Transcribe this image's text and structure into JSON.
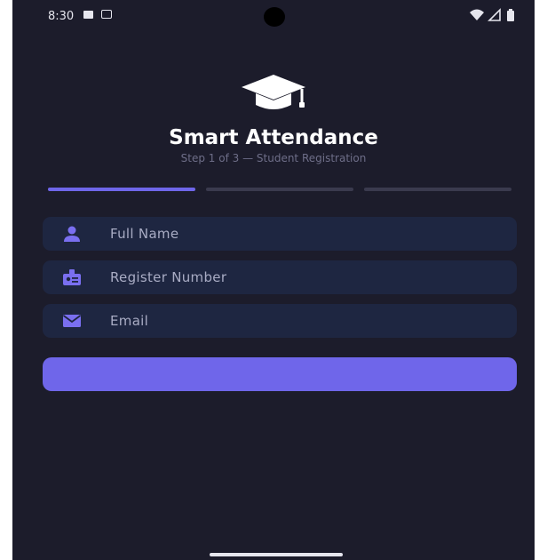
{
  "status_bar": {
    "time": "8:30",
    "icons": [
      "sd-card-icon",
      "screen-icon",
      "wifi-icon",
      "signal-icon",
      "battery-icon"
    ]
  },
  "header": {
    "icon": "graduation-cap-icon",
    "title": "Smart Attendance",
    "subtitle": "Step 1 of 3 — Student Registration"
  },
  "progress": {
    "current_step": 1,
    "total_steps": 3
  },
  "form": {
    "fields": [
      {
        "icon": "person-icon",
        "placeholder": "Full Name",
        "value": ""
      },
      {
        "icon": "id-badge-icon",
        "placeholder": "Register Number",
        "value": ""
      },
      {
        "icon": "email-icon",
        "placeholder": "Email",
        "value": ""
      }
    ],
    "submit_label": ""
  },
  "colors": {
    "background": "#1c1c2b",
    "accent": "#6f66ea",
    "field_bg": "#1e2641",
    "muted_text": "#6e6e88"
  }
}
